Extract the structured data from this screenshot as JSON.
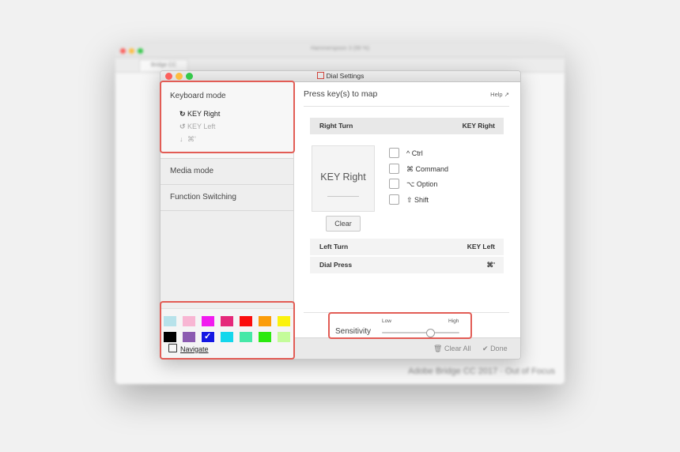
{
  "background_window": {
    "title": "Hammerspoon 3 (99 %)",
    "tab_label": "Bridge CC",
    "status_text": "Adobe Bridge CC 2017 · Out of Focus"
  },
  "window": {
    "title": "Dial Settings"
  },
  "sidebar": {
    "keyboard_mode": {
      "label": "Keyboard mode",
      "items": [
        {
          "icon": "rotate-cw-icon",
          "glyph": "↻",
          "label": "KEY Right"
        },
        {
          "icon": "rotate-ccw-icon",
          "glyph": "↺",
          "label": "KEY Left"
        },
        {
          "icon": "arrow-down-icon",
          "glyph": "↓",
          "label": "⌘'"
        }
      ]
    },
    "media_mode": "Media mode",
    "function_switching": "Function Switching"
  },
  "swatches": [
    {
      "color": "#b7e2ea"
    },
    {
      "color": "#f8b6d3"
    },
    {
      "color": "#f11bef"
    },
    {
      "color": "#e5297a"
    },
    {
      "color": "#fb0d0d"
    },
    {
      "color": "#fb9d0a"
    },
    {
      "color": "#fbf20d"
    },
    {
      "color": "#000000"
    },
    {
      "color": "#8b5bb0"
    },
    {
      "color": "#1417e3",
      "selected": true
    },
    {
      "color": "#14d7ec"
    },
    {
      "color": "#46e8a7"
    },
    {
      "color": "#2be90f"
    },
    {
      "color": "#c4fc9a"
    }
  ],
  "navigate_label": "Navigate",
  "main": {
    "header": "Press key(s) to map",
    "help": "Help",
    "right_turn": {
      "label": "Right Turn",
      "value": "KEY Right"
    },
    "key_preview": "KEY Right",
    "clear": "Clear",
    "modifiers": [
      {
        "label": "^ Ctrl",
        "checked": false
      },
      {
        "label": "⌘ Command",
        "checked": false
      },
      {
        "label": "⌥ Option",
        "checked": false
      },
      {
        "label": "⇧ Shift",
        "checked": false
      }
    ],
    "left_turn": {
      "label": "Left Turn",
      "value": "KEY Left"
    },
    "dial_press": {
      "label": "Dial Press",
      "value": "⌘'"
    }
  },
  "sensitivity": {
    "label": "Sensitivity",
    "low": "Low",
    "high": "High",
    "level": 0.62
  },
  "footer": {
    "clear_all": "Clear All",
    "done": "Done"
  },
  "highlight_color": "#e25c55"
}
